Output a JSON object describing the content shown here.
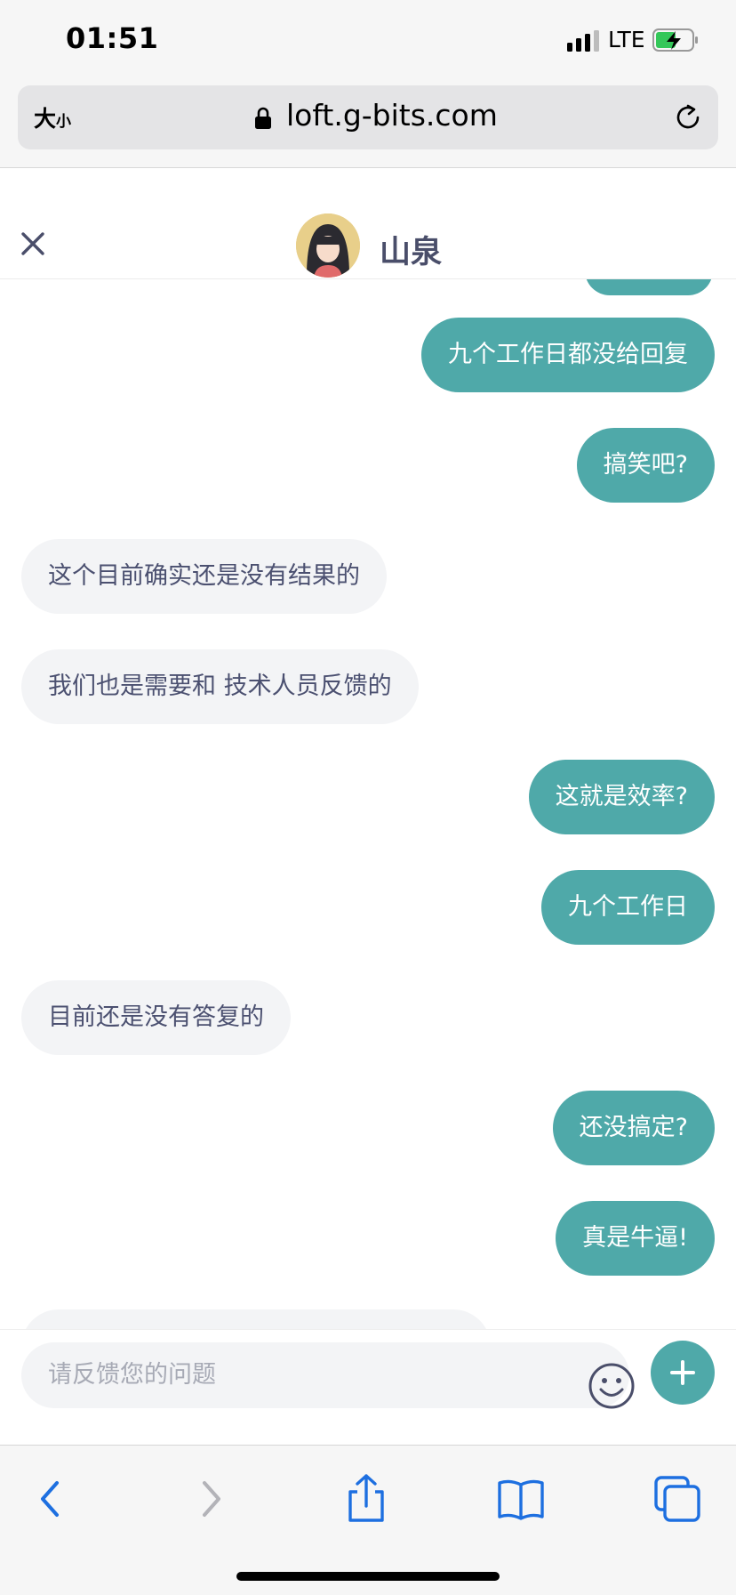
{
  "status_bar": {
    "time": "01:51",
    "network": "LTE"
  },
  "address_bar": {
    "text_size_big": "大",
    "text_size_small": "小",
    "url": "loft.g-bits.com"
  },
  "chat_header": {
    "agent_name": "山泉"
  },
  "messages": [
    {
      "direction": "out",
      "text": "九个工作日都没给回复"
    },
    {
      "direction": "out",
      "text": "搞笑吧?"
    },
    {
      "direction": "in",
      "text": "这个目前确实还是没有结果的"
    },
    {
      "direction": "in",
      "text": "我们也是需要和 技术人员反馈的"
    },
    {
      "direction": "out",
      "text": "这就是效率?"
    },
    {
      "direction": "out",
      "text": "九个工作日"
    },
    {
      "direction": "in",
      "text": "目前还是没有答复的"
    },
    {
      "direction": "out",
      "text": "还没搞定?"
    },
    {
      "direction": "out",
      "text": "真是牛逼!"
    }
  ],
  "input": {
    "placeholder": "请反馈您的问题"
  },
  "colors": {
    "accent": "#4fa9a9",
    "incoming_bubble": "#f3f4f6",
    "agent_name": "#4a4e6a"
  },
  "icons": [
    "lock-icon",
    "reload-icon",
    "close-icon",
    "emoji-icon",
    "plus-icon",
    "back-icon",
    "forward-icon",
    "share-icon",
    "bookmarks-icon",
    "tabs-icon"
  ]
}
